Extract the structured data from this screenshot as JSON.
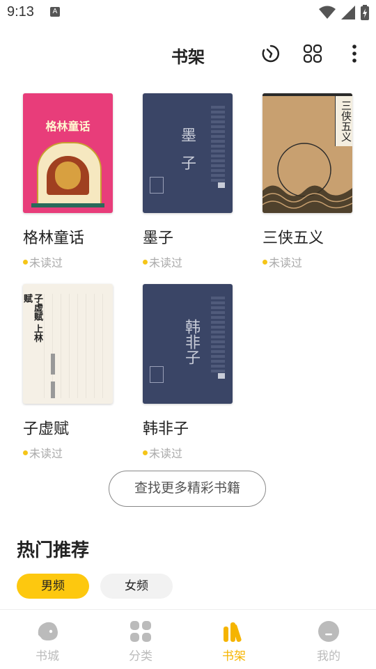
{
  "status_bar": {
    "time": "9:13",
    "notif_letter": "A"
  },
  "header": {
    "title": "书架"
  },
  "books": [
    {
      "title": "格林童话",
      "status": "未读过",
      "cover_text": "格林童话"
    },
    {
      "title": "墨子",
      "status": "未读过",
      "cover_text": "墨 子"
    },
    {
      "title": "三侠五义",
      "status": "未读过",
      "cover_text": "三侠五义"
    },
    {
      "title": "子虚赋",
      "status": "未读过",
      "cover_text": "子虚赋 上林赋"
    },
    {
      "title": "韩非子",
      "status": "未读过",
      "cover_text": "韩非子"
    }
  ],
  "find_more": "查找更多精彩书籍",
  "recommend": {
    "title": "热门推荐",
    "chips": [
      "男频",
      "女频"
    ]
  },
  "tabs": [
    {
      "label": "书城",
      "icon": "bookstore-icon"
    },
    {
      "label": "分类",
      "icon": "category-icon"
    },
    {
      "label": "书架",
      "icon": "bookshelf-icon"
    },
    {
      "label": "我的",
      "icon": "profile-icon"
    }
  ],
  "colors": {
    "accent": "#fdc80f",
    "active_tab": "#f5b400",
    "inactive_tab": "#bbbbbb"
  }
}
